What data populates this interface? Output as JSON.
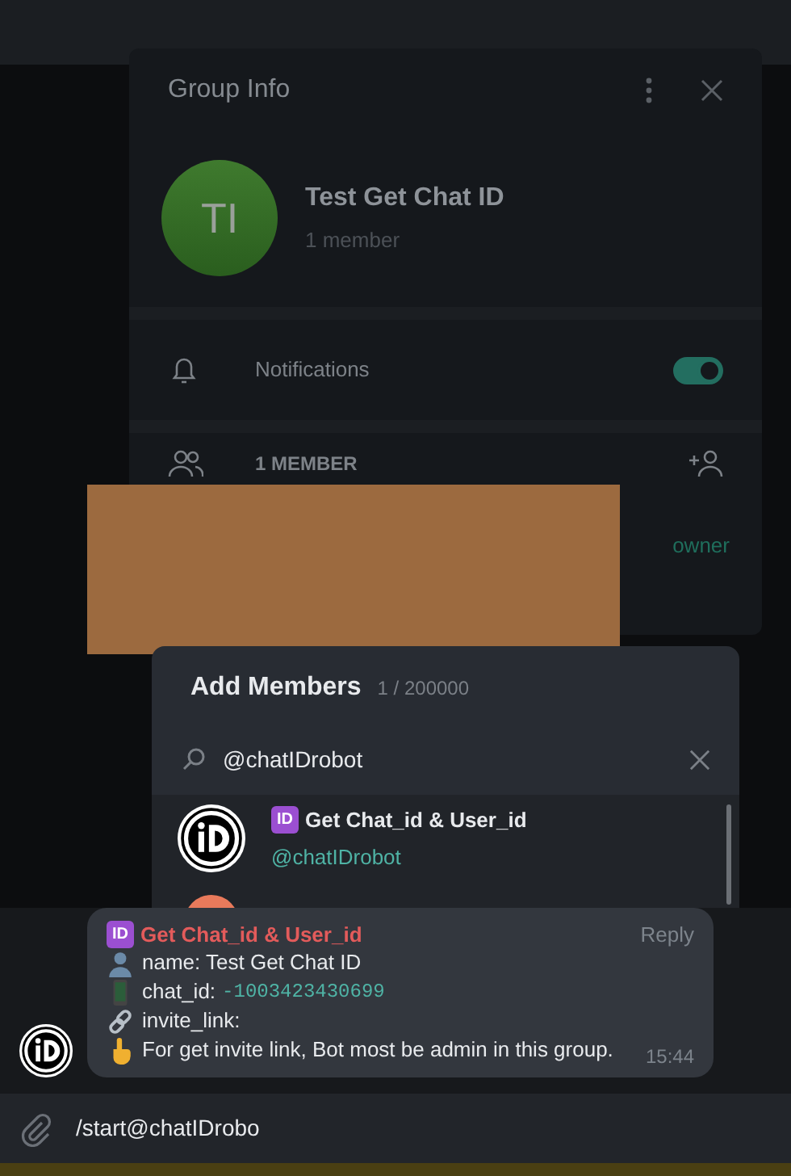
{
  "group_info": {
    "title": "Group Info",
    "avatar_initials": "TI",
    "group_name": "Test Get Chat ID",
    "subtitle": "1 member",
    "notifications": {
      "label": "Notifications",
      "on": true
    },
    "members": {
      "heading": "1 MEMBER",
      "role": "owner"
    }
  },
  "add_members": {
    "title": "Add Members",
    "count": "1 / 200000",
    "search": {
      "value": "@chatIDrobot"
    },
    "results": [
      {
        "badge": "ID",
        "name": "Get Chat_id & User_id",
        "handle": "@chatIDrobot"
      }
    ]
  },
  "message": {
    "sender_badge": "ID",
    "sender": "Get Chat_id & User_id",
    "reply": "Reply",
    "time": "15:44",
    "lines": [
      {
        "kind": "person",
        "text": "name: Test Get Chat ID"
      },
      {
        "kind": "phone",
        "text": "chat_id:",
        "code": "-1003423430699"
      },
      {
        "kind": "link",
        "text": "invite_link:"
      },
      {
        "kind": "pointer",
        "text": "For get invite link, Bot most be admin in this group."
      }
    ]
  },
  "composer": {
    "value": "/start@chatIDrobo"
  }
}
